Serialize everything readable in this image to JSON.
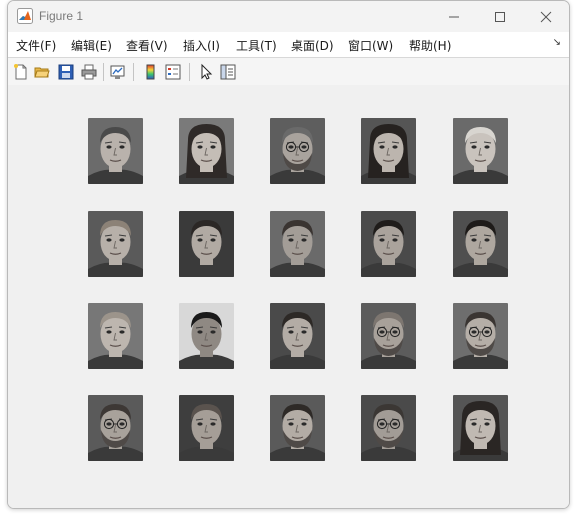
{
  "window": {
    "title": "Figure 1"
  },
  "menu": [
    {
      "label": "文件(F)"
    },
    {
      "label": "编辑(E)"
    },
    {
      "label": "查看(V)"
    },
    {
      "label": "插入(I)"
    },
    {
      "label": "工具(T)"
    },
    {
      "label": "桌面(D)"
    },
    {
      "label": "窗口(W)"
    },
    {
      "label": "帮助(H)"
    }
  ],
  "toolbar": [
    {
      "icon": "new-figure-icon"
    },
    {
      "icon": "open-file-icon"
    },
    {
      "icon": "save-icon"
    },
    {
      "icon": "print-icon"
    },
    {
      "icon": "link-plot-icon"
    },
    {
      "icon": "insert-colorbar-icon"
    },
    {
      "icon": "insert-legend-icon"
    },
    {
      "icon": "edit-plot-arrow-icon"
    },
    {
      "icon": "property-inspector-icon"
    }
  ],
  "faces": [
    {
      "bg": "#6b6b6b",
      "skin": "#b9b2ac",
      "hair": "#4a4a4a",
      "glasses": false,
      "beard": false,
      "long": false
    },
    {
      "bg": "#7a7a7a",
      "skin": "#c4bdb6",
      "hair": "#2f2a28",
      "glasses": false,
      "beard": false,
      "long": true
    },
    {
      "bg": "#5e5e5e",
      "skin": "#a9a39d",
      "hair": "#6a6a6a",
      "glasses": true,
      "beard": true,
      "long": false
    },
    {
      "bg": "#555555",
      "skin": "#bcb5ae",
      "hair": "#262220",
      "glasses": false,
      "beard": false,
      "long": true
    },
    {
      "bg": "#6a6a6a",
      "skin": "#c9c3bd",
      "hair": "#d8d5d0",
      "glasses": false,
      "beard": false,
      "long": false
    },
    {
      "bg": "#5a5a5a",
      "skin": "#b7b0a9",
      "hair": "#8c8277",
      "glasses": false,
      "beard": false,
      "long": false
    },
    {
      "bg": "#3a3a3a",
      "skin": "#b1aaa3",
      "hair": "#2b2725",
      "glasses": false,
      "beard": false,
      "long": false
    },
    {
      "bg": "#6a6a6a",
      "skin": "#a39d97",
      "hair": "#3a3431",
      "glasses": false,
      "beard": false,
      "long": false
    },
    {
      "bg": "#4a4a4a",
      "skin": "#aaa39c",
      "hair": "#1f1c1a",
      "glasses": false,
      "beard": false,
      "long": false
    },
    {
      "bg": "#4f4f4f",
      "skin": "#aea79f",
      "hair": "#1e1b19",
      "glasses": false,
      "beard": false,
      "long": false
    },
    {
      "bg": "#777777",
      "skin": "#bdb6af",
      "hair": "#9c948b",
      "glasses": false,
      "beard": false,
      "long": false
    },
    {
      "bg": "#d8d8d8",
      "skin": "#8f8983",
      "hair": "#1a1a1a",
      "glasses": false,
      "beard": false,
      "long": false
    },
    {
      "bg": "#4a4a4a",
      "skin": "#b3aca5",
      "hair": "#2d2926",
      "glasses": false,
      "beard": false,
      "long": false
    },
    {
      "bg": "#5c5c5c",
      "skin": "#a8a19a",
      "hair": "#7d7670",
      "glasses": true,
      "beard": true,
      "long": false
    },
    {
      "bg": "#6e6e6e",
      "skin": "#b5aea7",
      "hair": "#3a3532",
      "glasses": true,
      "beard": true,
      "long": false
    },
    {
      "bg": "#5a5a5a",
      "skin": "#a8a29b",
      "hair": "#3d3835",
      "glasses": true,
      "beard": true,
      "long": false
    },
    {
      "bg": "#3e3e3e",
      "skin": "#a59e97",
      "hair": "#5a534e",
      "glasses": false,
      "beard": false,
      "long": false
    },
    {
      "bg": "#5a5a5a",
      "skin": "#b3aca5",
      "hair": "#2e2a27",
      "glasses": false,
      "beard": true,
      "long": false
    },
    {
      "bg": "#4a4a4a",
      "skin": "#a29c96",
      "hair": "#3b3734",
      "glasses": true,
      "beard": true,
      "long": false
    },
    {
      "bg": "#555555",
      "skin": "#c0b9b2",
      "hair": "#2a2624",
      "glasses": false,
      "beard": false,
      "long": true
    }
  ]
}
